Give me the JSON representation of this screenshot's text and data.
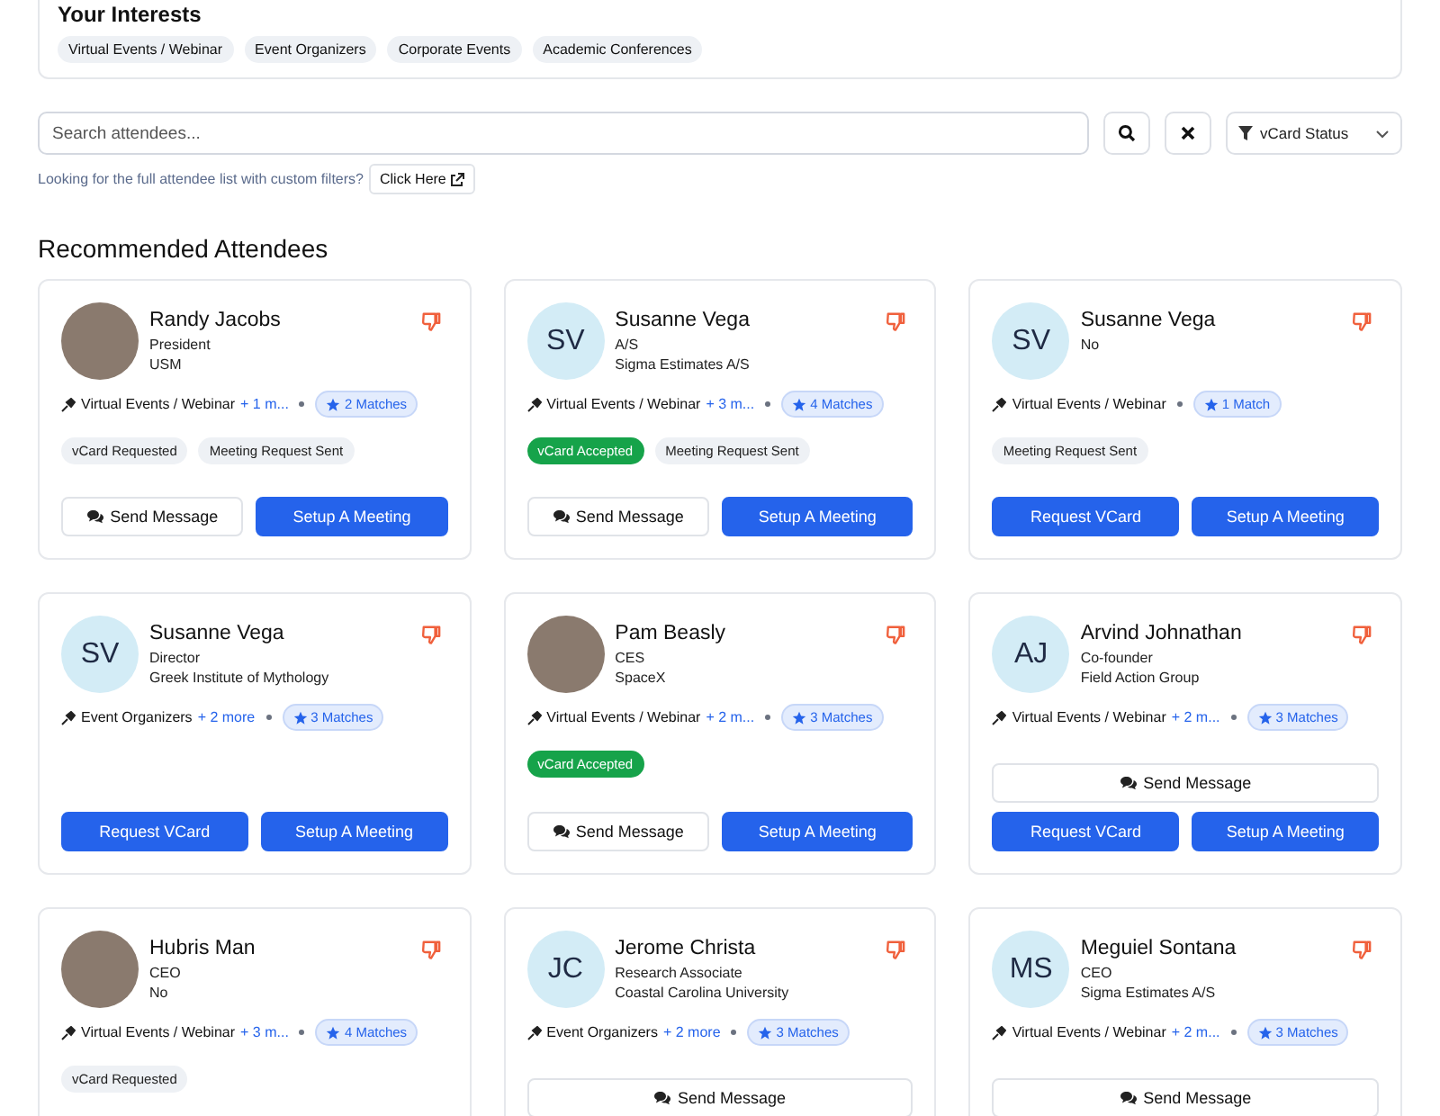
{
  "interests": {
    "title": "Your Interests",
    "items": [
      "Virtual Events / Webinar",
      "Event Organizers",
      "Corporate Events",
      "Academic Conferences"
    ]
  },
  "search": {
    "placeholder": "Search attendees...",
    "filter_label": "vCard Status"
  },
  "hint": {
    "text": "Looking for the full attendee list with custom filters?",
    "button": "Click Here"
  },
  "section_title": "Recommended Attendees",
  "attendees": [
    {
      "name": "Randy Jacobs",
      "details": [
        "President",
        "USM"
      ],
      "avatar": {
        "kind": "photo"
      },
      "interest": "Virtual Events / Webinar",
      "more": "+ 1 m...",
      "matches": "2 Matches",
      "tags": [
        {
          "label": "vCard Requested",
          "kind": "neutral"
        },
        {
          "label": "Meeting Request Sent",
          "kind": "neutral"
        }
      ],
      "button_rows": [
        [
          {
            "label": "Send Message",
            "kind": "message"
          },
          {
            "label": "Setup A Meeting",
            "kind": "primary"
          }
        ]
      ]
    },
    {
      "name": "Susanne Vega",
      "details": [
        "A/S",
        "Sigma Estimates A/S"
      ],
      "avatar": {
        "kind": "initials",
        "initials": "SV"
      },
      "interest": "Virtual Events / Webinar",
      "more": "+ 3 m...",
      "matches": "4 Matches",
      "tags": [
        {
          "label": "vCard Accepted",
          "kind": "accepted"
        },
        {
          "label": "Meeting Request Sent",
          "kind": "neutral"
        }
      ],
      "button_rows": [
        [
          {
            "label": "Send Message",
            "kind": "message"
          },
          {
            "label": "Setup A Meeting",
            "kind": "primary"
          }
        ]
      ]
    },
    {
      "name": "Susanne Vega",
      "details": [
        "No"
      ],
      "avatar": {
        "kind": "initials",
        "initials": "SV"
      },
      "interest": "Virtual Events / Webinar",
      "matches": "1 Match",
      "tags": [
        {
          "label": "Meeting Request Sent",
          "kind": "neutral"
        }
      ],
      "button_rows": [
        [
          {
            "label": "Request VCard",
            "kind": "primary"
          },
          {
            "label": "Setup A Meeting",
            "kind": "primary"
          }
        ]
      ]
    },
    {
      "name": "Susanne Vega",
      "details": [
        "Director",
        "Greek Institute of Mythology"
      ],
      "avatar": {
        "kind": "initials",
        "initials": "SV"
      },
      "interest": "Event Organizers",
      "more": "+ 2 more",
      "matches": "3 Matches",
      "button_rows": [
        [
          {
            "label": "Request VCard",
            "kind": "primary"
          },
          {
            "label": "Setup A Meeting",
            "kind": "primary"
          }
        ]
      ]
    },
    {
      "name": "Pam Beasly",
      "details": [
        "CES",
        "SpaceX"
      ],
      "avatar": {
        "kind": "photo"
      },
      "interest": "Virtual Events / Webinar",
      "more": "+ 2 m...",
      "matches": "3 Matches",
      "tags": [
        {
          "label": "vCard Accepted",
          "kind": "accepted"
        }
      ],
      "button_rows": [
        [
          {
            "label": "Send Message",
            "kind": "message"
          },
          {
            "label": "Setup A Meeting",
            "kind": "primary"
          }
        ]
      ]
    },
    {
      "name": "Arvind Johnathan",
      "details": [
        "Co-founder",
        "Field Action Group"
      ],
      "avatar": {
        "kind": "initials",
        "initials": "AJ"
      },
      "interest": "Virtual Events / Webinar",
      "more": "+ 2 m...",
      "matches": "3 Matches",
      "button_rows": [
        [
          {
            "label": "Send Message",
            "kind": "message"
          }
        ],
        [
          {
            "label": "Request VCard",
            "kind": "primary"
          },
          {
            "label": "Setup A Meeting",
            "kind": "primary"
          }
        ]
      ]
    },
    {
      "name": "Hubris Man",
      "details": [
        "CEO",
        "No"
      ],
      "avatar": {
        "kind": "photo"
      },
      "interest": "Virtual Events / Webinar",
      "more": "+ 3 m...",
      "matches": "4 Matches",
      "tags": [
        {
          "label": "vCard Requested",
          "kind": "neutral"
        }
      ]
    },
    {
      "name": "Jerome Christa",
      "details": [
        "Research Associate",
        "Coastal Carolina University"
      ],
      "avatar": {
        "kind": "initials",
        "initials": "JC"
      },
      "interest": "Event Organizers",
      "more": "+ 2 more",
      "matches": "3 Matches",
      "button_rows": [
        [
          {
            "label": "Send Message",
            "kind": "message"
          }
        ]
      ]
    },
    {
      "name": "Meguiel Sontana",
      "details": [
        "CEO",
        "Sigma Estimates A/S"
      ],
      "avatar": {
        "kind": "initials",
        "initials": "MS"
      },
      "interest": "Virtual Events / Webinar",
      "more": "+ 2 m...",
      "matches": "3 Matches",
      "button_rows": [
        [
          {
            "label": "Send Message",
            "kind": "message"
          }
        ]
      ]
    }
  ]
}
